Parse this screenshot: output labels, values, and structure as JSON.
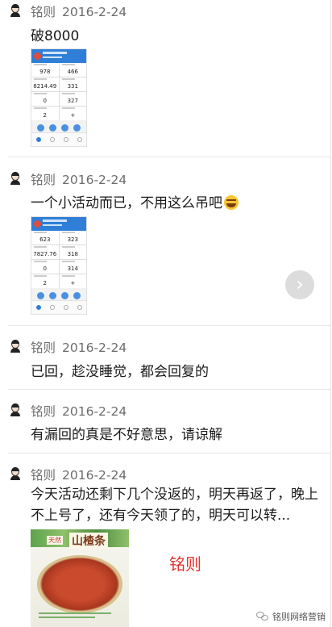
{
  "posts": [
    {
      "author": "铭则",
      "date": "2016-2-24",
      "text": "破8000",
      "screenshot": {
        "cells": [
          "978",
          "466",
          "8214.49",
          "331",
          "0",
          "327",
          "2",
          "+"
        ]
      }
    },
    {
      "author": "铭则",
      "date": "2016-2-24",
      "text": "一个小活动而已，不用这么吊吧",
      "emoji": "laughing-tears-emoji",
      "screenshot": {
        "cells": [
          "623",
          "323",
          "7827.76",
          "318",
          "0",
          "314",
          "2",
          "+"
        ]
      }
    },
    {
      "author": "铭则",
      "date": "2016-2-24",
      "text": "已回，趁没睡觉，都会回复的"
    },
    {
      "author": "铭则",
      "date": "2016-2-24",
      "text": "有漏回的真是不好意思，请谅解"
    },
    {
      "author": "铭则",
      "date": "2016-2-24",
      "text": "今天活动还剩下几个没返的，明天再返了，晚上不上号了，还有今天领了的，明天可以转...",
      "image": {
        "brand": "山楂条",
        "tag": "天然"
      },
      "signature": "铭则"
    }
  ],
  "next_button": {
    "icon": "chevron-right-icon",
    "glyph": "›"
  },
  "watermark": {
    "text": "铭则网络营销"
  },
  "colors": {
    "accent_blue": "#2f7fd8",
    "signature_red": "#e6322b",
    "divider": "#e5e5e5"
  }
}
